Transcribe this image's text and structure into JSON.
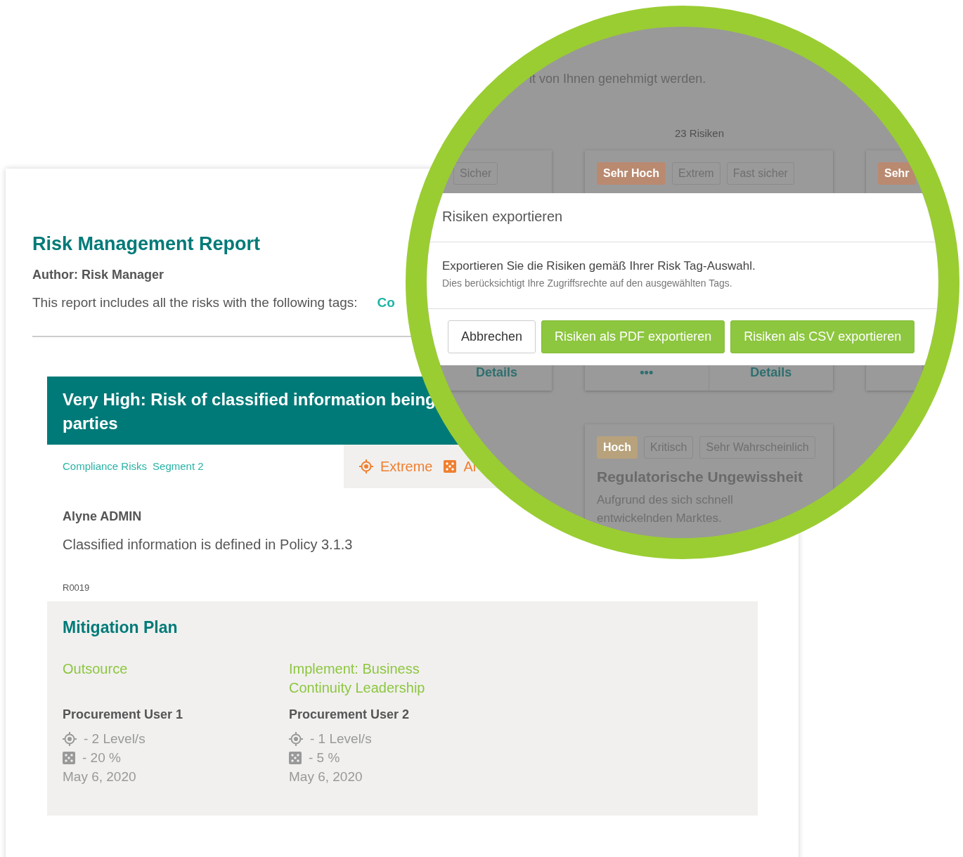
{
  "report": {
    "title": "Risk Management Report",
    "author": "Author: Risk Manager",
    "tags_intro": "This report includes all the risks with the following tags:",
    "tags": [
      "Co"
    ]
  },
  "risk": {
    "title_lines": [
      "Very High: Risk of classified information being",
      "parties"
    ],
    "tags": [
      "Compliance Risks",
      "Segment 2"
    ],
    "impact": "Extreme",
    "likelihood": "Al",
    "owner": "Alyne ADMIN",
    "description": "Classified information is defined in Policy 3.1.3",
    "id": "R0019"
  },
  "mitigation_plan": {
    "title": "Mitigation Plan",
    "measures": [
      {
        "name": "Outsource",
        "owner": "Procurement User 1",
        "impact_reduction": "- 2 Level/s",
        "likelihood_reduction": "- 20 %",
        "date": "May 6, 2020"
      },
      {
        "name": "Implement: Business Continuity Leadership",
        "owner": "Procurement User 2",
        "impact_reduction": "- 1 Level/s",
        "likelihood_reduction": "- 5 %",
        "date": "May 6, 2020"
      }
    ]
  },
  "magnifier": {
    "notice": "it von Ihnen genehmigt werden.",
    "count": "23 Risiken",
    "card_rows": [
      [
        {
          "tags": [
            {
              "label": "Sicher",
              "kind": "plain"
            }
          ],
          "footer": [
            "Details"
          ]
        },
        {
          "tags": [
            {
              "label": "Sehr Hoch",
              "kind": "level",
              "color": "#b98a70"
            },
            {
              "label": "Extrem",
              "kind": "plain"
            },
            {
              "label": "Fast sicher",
              "kind": "plain"
            }
          ],
          "footer": [
            "•••",
            "Details"
          ]
        },
        {
          "tags": [
            {
              "label": "Sehr",
              "kind": "level",
              "color": "#b98a70"
            }
          ]
        }
      ],
      [
        {
          "tags": [
            {
              "label": "Hoch",
              "kind": "level",
              "color": "#b8a27c"
            },
            {
              "label": "Kritisch",
              "kind": "plain"
            },
            {
              "label": "Sehr Wahrscheinlich",
              "kind": "plain"
            }
          ],
          "title": "Regulatorische Ungewissheit",
          "description": "Aufgrund des sich schnell entwickelnden Marktes."
        }
      ]
    ],
    "dialog": {
      "title": "Risiken exportieren",
      "message": "Exportieren Sie die Risiken gemäß Ihrer Risk Tag-Auswahl.",
      "note": "Dies berücksichtigt Ihre Zugriffsrechte auf den ausgewählten Tags.",
      "buttons": [
        {
          "label": "Abbrechen",
          "kind": "secondary"
        },
        {
          "label": "Risiken als PDF exportieren",
          "kind": "primary"
        },
        {
          "label": "Risiken als CSV exportieren",
          "kind": "primary"
        }
      ]
    }
  }
}
